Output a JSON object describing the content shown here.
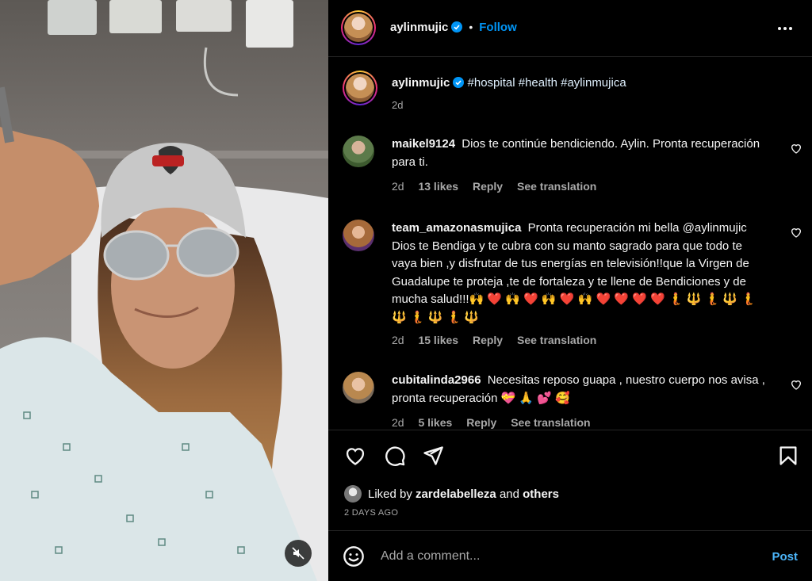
{
  "media": {
    "mute_icon": "speaker-muted-icon"
  },
  "header": {
    "username": "aylinmujic",
    "separator": "•",
    "follow_label": "Follow",
    "verified_icon": "verified-badge-icon",
    "more_icon": "more-options-icon"
  },
  "caption": {
    "username": "aylinmujic",
    "text": "#hospital #health #aylinmujica",
    "time": "2d"
  },
  "comments": [
    {
      "username": "maikel9124",
      "text": "Dios te continúe bendiciendo. Aylin. Pronta recuperación para ti.",
      "time": "2d",
      "likes": "13 likes",
      "reply": "Reply",
      "translation": "See translation"
    },
    {
      "username": "team_amazonasmujica",
      "text": "Pronta recuperación mi bella @aylinmujic Dios te Bendiga y te cubra con su manto sagrado para que todo te vaya bien ,y disfrutar de tus energías en televisión!!que la Virgen de Guadalupe te proteja ,te de fortaleza y te llene de Bendiciones y de mucha salud!!!🙌 ❤️ 🙌 ❤️ 🙌 ❤️ 🙌 ❤️ ❤️ ❤️ ❤️ 🧜 🔱 🧜 🔱 🧜 🔱 🧜 🔱 🧜 🔱",
      "time": "2d",
      "likes": "15 likes",
      "reply": "Reply",
      "translation": "See translation"
    },
    {
      "username": "cubitalinda2966",
      "text": "Necesitas reposo guapa , nuestro cuerpo nos avisa , pronta recuperación 💝 🙏 💕 🥰",
      "time": "2d",
      "likes": "5 likes",
      "reply": "Reply",
      "translation": "See translation"
    }
  ],
  "actions": {
    "like_icon": "heart-icon",
    "comment_icon": "comment-icon",
    "share_icon": "paper-plane-icon",
    "save_icon": "bookmark-icon"
  },
  "liked_by": {
    "prefix": "Liked by",
    "user": "zardelabelleza",
    "conj": "and",
    "others": "others"
  },
  "date": "2 DAYS AGO",
  "comment_bar": {
    "emoji_icon": "emoji-icon",
    "placeholder": "Add a comment...",
    "post_label": "Post"
  },
  "colors": {
    "link": "#0095f6",
    "post": "#4cb5f9",
    "secondary_text": "#a8a8a8",
    "divider": "#262626"
  }
}
